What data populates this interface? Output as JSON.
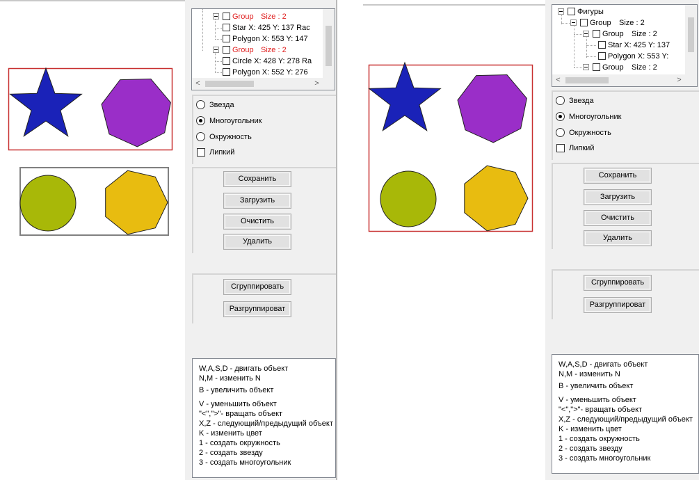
{
  "colors": {
    "star": "#1a22b8",
    "heptagon_purple": "#9a2ec8",
    "circle": "#a8b808",
    "heptagon_yellow": "#e8bc10",
    "selection": "#c83030",
    "group_frame": "#808080",
    "group_text": "#e02020"
  },
  "left": {
    "tree": [
      {
        "label": "Group",
        "size": "Size : 2",
        "is_group": true
      },
      {
        "label": "Star  X: 425 Y: 137 Rac",
        "is_group": false
      },
      {
        "label": "Polygon  X: 553 Y: 147",
        "is_group": false
      },
      {
        "label": "Group",
        "size": "Size : 2",
        "is_group": true
      },
      {
        "label": "Circle  X: 428 Y: 278 Ra",
        "is_group": false
      },
      {
        "label": "Polygon  X: 552 Y: 276",
        "is_group": false
      }
    ],
    "scroll_left": "<",
    "scroll_right": ">"
  },
  "right": {
    "tree": [
      {
        "label": "Фигуры",
        "is_group": false
      },
      {
        "label": "Group",
        "size": "Size : 2",
        "is_group": false
      },
      {
        "label": "Group",
        "size": "Size : 2",
        "is_group": false
      },
      {
        "label": "Star  X: 425 Y: 137",
        "is_group": false
      },
      {
        "label": "Polygon  X: 553 Y:",
        "is_group": false
      },
      {
        "label": "Group",
        "size": "Size : 2",
        "is_group": false
      }
    ],
    "scroll_left": "<",
    "scroll_right": ">"
  },
  "options": {
    "star": "Звезда",
    "polygon": "Многоугольник",
    "circle": "Окружность",
    "sticky": "Липкий",
    "selected": "polygon",
    "sticky_checked": false
  },
  "buttons": {
    "save": "Сохранить",
    "load": "Загрузить",
    "clear": "Очистить",
    "delete": "Удалить",
    "group": "Сгруппировать",
    "ungroup": "Разгруппироват"
  },
  "help": [
    "W,A,S,D - двигать объект",
    "N,M - изменить N",
    "B - увеличить объект",
    "V - уменьшить объект",
    "\"<\",\">\"- вращать объект",
    " X,Z - следующий/предыдущий объект",
    " K - изменить цвет",
    "1 - создать окружность",
    "2 - создать звезду",
    "3 - создать многоугольник"
  ]
}
